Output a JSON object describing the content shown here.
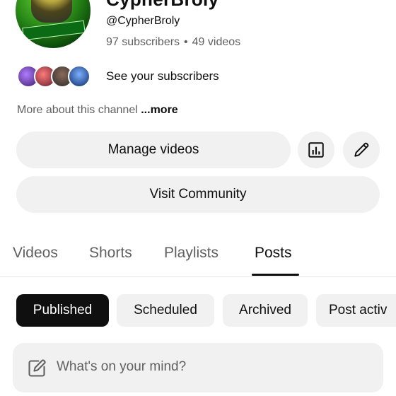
{
  "channel": {
    "title_fragment": "CypherBroly",
    "handle": "@CypherBroly",
    "subscribers": "97 subscribers",
    "separator": "•",
    "videos": "49 videos",
    "see_subscribers": "See your subscribers",
    "more_about_prefix": "More about this channel",
    "more_about_link": "...more"
  },
  "buttons": {
    "manage_videos": "Manage videos",
    "visit_community": "Visit Community",
    "analytics_icon": "analytics-icon",
    "edit_icon": "pencil-icon"
  },
  "tabs": [
    {
      "label": "Videos"
    },
    {
      "label": "Shorts"
    },
    {
      "label": "Playlists"
    },
    {
      "label": "Posts",
      "active": true
    }
  ],
  "chips": [
    {
      "label": "Published",
      "selected": true
    },
    {
      "label": "Scheduled"
    },
    {
      "label": "Archived"
    },
    {
      "label": "Post activ"
    }
  ],
  "composer": {
    "placeholder": "What's on your mind?",
    "icon": "edit-square-icon"
  }
}
